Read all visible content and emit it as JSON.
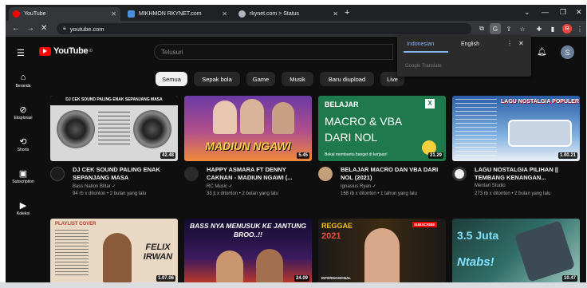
{
  "browser": {
    "tabs": [
      {
        "title": "YouTube",
        "active": true,
        "icon": "youtube-favicon",
        "color": "#ff0000"
      },
      {
        "title": "MIKHMON RKYNET.com",
        "active": false,
        "icon": "mikhmon-favicon",
        "color": "#4a8fd8"
      },
      {
        "title": "rkynet.com > Status",
        "active": false,
        "icon": "rkynet-favicon",
        "color": "#b0b6c0"
      }
    ],
    "address": "youtube.com",
    "profile_initial": "R"
  },
  "translate_popup": {
    "lang_active": "Indonesian",
    "lang_other": "English",
    "footer": "Google Translate"
  },
  "youtube": {
    "logo_text": "YouTube",
    "logo_country": "ID",
    "search_placeholder": "Telusuri",
    "avatar_initial": "S",
    "sidebar": [
      {
        "label": "Beranda",
        "icon": "home-icon"
      },
      {
        "label": "Eksplorasi",
        "icon": "compass-icon"
      },
      {
        "label": "Shorts",
        "icon": "shorts-icon"
      },
      {
        "label": "Subscription",
        "icon": "subscriptions-icon"
      },
      {
        "label": "Koleksi",
        "icon": "library-icon"
      }
    ],
    "chips": [
      "Semua",
      "Sepak bola",
      "Game",
      "Musik",
      "Baru diupload",
      "Live"
    ],
    "videos": [
      {
        "title": "DJ CEK SOUND PALING ENAK SEPANJANG MASA",
        "channel": "Bass Nation Blitar ✓",
        "meta": "94 rb x ditonton • 2 bulan yang lalu",
        "duration": "42.48",
        "overlay": "DJ CEK SOUND PALING ENAK SEPANJANG MASA"
      },
      {
        "title": "HAPPY ASMARA Ft DENNY CAKNAN - MADIUN NGAWI (...",
        "channel": "RC Music ✓",
        "meta": "33 jt x ditonton • 2 bulan yang lalu",
        "duration": "5.45",
        "overlay": "MADIUN NGAWI"
      },
      {
        "title": "BELAJAR MACRO DAN VBA DARI NOL (2021)",
        "channel": "Ignasius Ryan ✓",
        "meta": "168 rb x ditonton • 1 tahun yang lalu",
        "duration": "21.29",
        "overlay": "BELAJAR",
        "overlay2": "MACRO & VBA",
        "overlay3": "DARI NOL",
        "overlay4": "Bekal membantu banget di kerjaan!"
      },
      {
        "title": "LAGU NOSTALGIA PILIHAN || TEMBANG KENANGAN...",
        "channel": "Mentari Studio",
        "meta": "273 rb x ditonton • 2 bulan yang lalu",
        "duration": "1.00.21",
        "overlay": "LAGU NOSTALGIA POPULER"
      },
      {
        "title": "",
        "channel": "",
        "meta": "",
        "duration": "1.07.06",
        "overlay": "PLAYLIST COVER",
        "overlay2": "FELIX IRWAN"
      },
      {
        "title": "",
        "channel": "",
        "meta": "",
        "duration": "24.09",
        "overlay": "BASS NYA MENUSUK KE JANTUNG BROO..!!"
      },
      {
        "title": "",
        "channel": "",
        "meta": "",
        "duration": "",
        "overlay": "REGGAE",
        "overlay2": "2021",
        "overlay3": "INTERNASIONAL",
        "overlay4": "SUBSCRIBE"
      },
      {
        "title": "",
        "channel": "",
        "meta": "",
        "duration": "10.47",
        "overlay": "3.5 Juta",
        "overlay2": "Ntabs!"
      }
    ]
  }
}
